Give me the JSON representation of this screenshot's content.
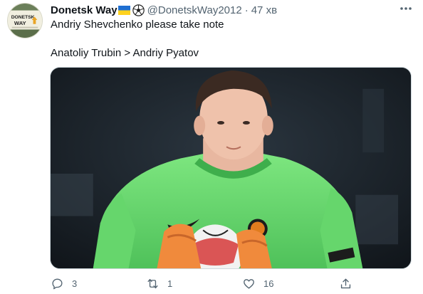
{
  "tweet": {
    "display_name": "Donetsk Way",
    "name_emojis": [
      "ukraine-flag-icon",
      "soccer-ball-icon"
    ],
    "handle": "@DonetskWay2012",
    "separator": "·",
    "time": "47 хв",
    "text_lines": [
      "Andriy Shevchenko please take note",
      "",
      "Anatoliy Trubin > Andriy Pyatov"
    ],
    "avatar_text": {
      "line1": "DONETSK",
      "line2": "WAY"
    },
    "media_alt": "Goalkeeper in green kit holding a ball",
    "actions": {
      "reply_count": "3",
      "retweet_count": "1",
      "like_count": "16",
      "share_icon": "share-icon"
    }
  },
  "colors": {
    "text_primary": "#0f1419",
    "text_secondary": "#536471",
    "jersey_green": "#6fdc74",
    "media_background": "#1c232b"
  }
}
